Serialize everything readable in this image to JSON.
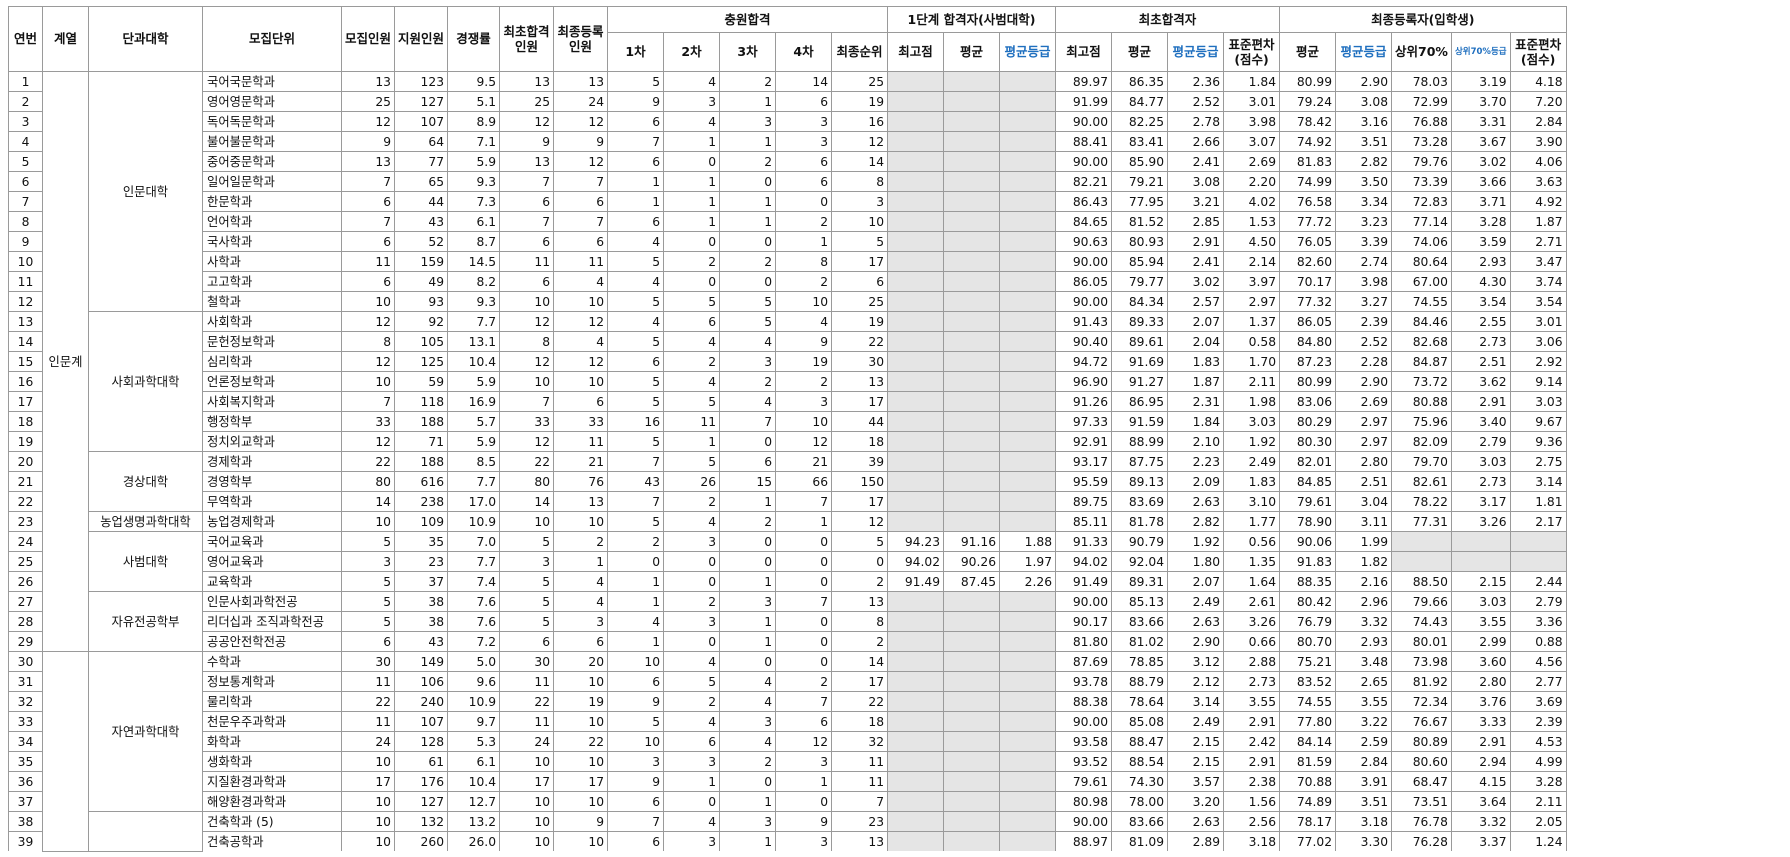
{
  "headers": {
    "idx": "연번",
    "field": "계열",
    "college": "단과대학",
    "unit": "모집단위",
    "quota": "모집인원",
    "applicants": "지원인원",
    "ratio": "경쟁률",
    "init_pass": "최초합격 인원",
    "final_reg": "최종등록 인원",
    "waitlist": "충원합격",
    "w1": "1차",
    "w2": "2차",
    "w3": "3차",
    "w4": "4차",
    "final_rank": "최종순위",
    "stage1": "1단계 합격자(사범대학)",
    "s1_max": "최고점",
    "s1_avg": "평균",
    "s1_grade": "평균등급",
    "initial": "최초합격자",
    "i_max": "최고점",
    "i_avg": "평균",
    "i_grade": "평균등급",
    "i_sd": "표준편차 (점수)",
    "finalreg": "최종등록자(입학생)",
    "f_avg": "평균",
    "f_grade": "평균등급",
    "f_top70": "상위70%",
    "f_top70g": "상위70%등급",
    "f_sd": "표준편차 (점수)"
  },
  "fields": [
    {
      "name": "인문계",
      "span": 29
    },
    {
      "name": "",
      "span": 10
    }
  ],
  "colleges": [
    {
      "name": "인문대학",
      "span": 12
    },
    {
      "name": "사회과학대학",
      "span": 7
    },
    {
      "name": "경상대학",
      "span": 3
    },
    {
      "name": "농업생명과학대학",
      "span": 1
    },
    {
      "name": "사범대학",
      "span": 3
    },
    {
      "name": "자유전공학부",
      "span": 3
    },
    {
      "name": "자연과학대학",
      "span": 8
    },
    {
      "name": "",
      "span": 2
    }
  ],
  "rows": [
    [
      "1",
      "국어국문학과",
      "13",
      "123",
      "9.5",
      "13",
      "13",
      "5",
      "4",
      "2",
      "14",
      "25",
      "",
      "",
      "",
      "89.97",
      "86.35",
      "2.36",
      "1.84",
      "80.99",
      "2.90",
      "78.03",
      "3.19",
      "4.18"
    ],
    [
      "2",
      "영어영문학과",
      "25",
      "127",
      "5.1",
      "25",
      "24",
      "9",
      "3",
      "1",
      "6",
      "19",
      "",
      "",
      "",
      "91.99",
      "84.77",
      "2.52",
      "3.01",
      "79.24",
      "3.08",
      "72.99",
      "3.70",
      "7.20"
    ],
    [
      "3",
      "독어독문학과",
      "12",
      "107",
      "8.9",
      "12",
      "12",
      "6",
      "4",
      "3",
      "3",
      "16",
      "",
      "",
      "",
      "90.00",
      "82.25",
      "2.78",
      "3.98",
      "78.42",
      "3.16",
      "76.88",
      "3.31",
      "2.84"
    ],
    [
      "4",
      "불어불문학과",
      "9",
      "64",
      "7.1",
      "9",
      "9",
      "7",
      "1",
      "1",
      "3",
      "12",
      "",
      "",
      "",
      "88.41",
      "83.41",
      "2.66",
      "3.07",
      "74.92",
      "3.51",
      "73.28",
      "3.67",
      "3.90"
    ],
    [
      "5",
      "중어중문학과",
      "13",
      "77",
      "5.9",
      "13",
      "12",
      "6",
      "0",
      "2",
      "6",
      "14",
      "",
      "",
      "",
      "90.00",
      "85.90",
      "2.41",
      "2.69",
      "81.83",
      "2.82",
      "79.76",
      "3.02",
      "4.06"
    ],
    [
      "6",
      "일어일문학과",
      "7",
      "65",
      "9.3",
      "7",
      "7",
      "1",
      "1",
      "0",
      "6",
      "8",
      "",
      "",
      "",
      "82.21",
      "79.21",
      "3.08",
      "2.20",
      "74.99",
      "3.50",
      "73.39",
      "3.66",
      "3.63"
    ],
    [
      "7",
      "한문학과",
      "6",
      "44",
      "7.3",
      "6",
      "6",
      "1",
      "1",
      "1",
      "0",
      "3",
      "",
      "",
      "",
      "86.43",
      "77.95",
      "3.21",
      "4.02",
      "76.58",
      "3.34",
      "72.83",
      "3.71",
      "4.92"
    ],
    [
      "8",
      "언어학과",
      "7",
      "43",
      "6.1",
      "7",
      "7",
      "6",
      "1",
      "1",
      "2",
      "10",
      "",
      "",
      "",
      "84.65",
      "81.52",
      "2.85",
      "1.53",
      "77.72",
      "3.23",
      "77.14",
      "3.28",
      "1.87"
    ],
    [
      "9",
      "국사학과",
      "6",
      "52",
      "8.7",
      "6",
      "6",
      "4",
      "0",
      "0",
      "1",
      "5",
      "",
      "",
      "",
      "90.63",
      "80.93",
      "2.91",
      "4.50",
      "76.05",
      "3.39",
      "74.06",
      "3.59",
      "2.71"
    ],
    [
      "10",
      "사학과",
      "11",
      "159",
      "14.5",
      "11",
      "11",
      "5",
      "2",
      "2",
      "8",
      "17",
      "",
      "",
      "",
      "90.00",
      "85.94",
      "2.41",
      "2.14",
      "82.60",
      "2.74",
      "80.64",
      "2.93",
      "3.47"
    ],
    [
      "11",
      "고고학과",
      "6",
      "49",
      "8.2",
      "6",
      "4",
      "4",
      "0",
      "0",
      "2",
      "6",
      "",
      "",
      "",
      "86.05",
      "79.77",
      "3.02",
      "3.97",
      "70.17",
      "3.98",
      "67.00",
      "4.30",
      "3.74"
    ],
    [
      "12",
      "철학과",
      "10",
      "93",
      "9.3",
      "10",
      "10",
      "5",
      "5",
      "5",
      "10",
      "25",
      "",
      "",
      "",
      "90.00",
      "84.34",
      "2.57",
      "2.97",
      "77.32",
      "3.27",
      "74.55",
      "3.54",
      "3.54"
    ],
    [
      "13",
      "사회학과",
      "12",
      "92",
      "7.7",
      "12",
      "12",
      "4",
      "6",
      "5",
      "4",
      "19",
      "",
      "",
      "",
      "91.43",
      "89.33",
      "2.07",
      "1.37",
      "86.05",
      "2.39",
      "84.46",
      "2.55",
      "3.01"
    ],
    [
      "14",
      "문헌정보학과",
      "8",
      "105",
      "13.1",
      "8",
      "4",
      "5",
      "4",
      "4",
      "9",
      "22",
      "",
      "",
      "",
      "90.40",
      "89.61",
      "2.04",
      "0.58",
      "84.80",
      "2.52",
      "82.68",
      "2.73",
      "3.06"
    ],
    [
      "15",
      "심리학과",
      "12",
      "125",
      "10.4",
      "12",
      "12",
      "6",
      "2",
      "3",
      "19",
      "30",
      "",
      "",
      "",
      "94.72",
      "91.69",
      "1.83",
      "1.70",
      "87.23",
      "2.28",
      "84.87",
      "2.51",
      "2.92"
    ],
    [
      "16",
      "언론정보학과",
      "10",
      "59",
      "5.9",
      "10",
      "10",
      "5",
      "4",
      "2",
      "2",
      "13",
      "",
      "",
      "",
      "96.90",
      "91.27",
      "1.87",
      "2.11",
      "80.99",
      "2.90",
      "73.72",
      "3.62",
      "9.14"
    ],
    [
      "17",
      "사회복지학과",
      "7",
      "118",
      "16.9",
      "7",
      "6",
      "5",
      "5",
      "4",
      "3",
      "17",
      "",
      "",
      "",
      "91.26",
      "86.95",
      "2.31",
      "1.98",
      "83.06",
      "2.69",
      "80.88",
      "2.91",
      "3.03"
    ],
    [
      "18",
      "행정학부",
      "33",
      "188",
      "5.7",
      "33",
      "33",
      "16",
      "11",
      "7",
      "10",
      "44",
      "",
      "",
      "",
      "97.33",
      "91.59",
      "1.84",
      "3.03",
      "80.29",
      "2.97",
      "75.96",
      "3.40",
      "9.67"
    ],
    [
      "19",
      "정치외교학과",
      "12",
      "71",
      "5.9",
      "12",
      "11",
      "5",
      "1",
      "0",
      "12",
      "18",
      "",
      "",
      "",
      "92.91",
      "88.99",
      "2.10",
      "1.92",
      "80.30",
      "2.97",
      "82.09",
      "2.79",
      "9.36"
    ],
    [
      "20",
      "경제학과",
      "22",
      "188",
      "8.5",
      "22",
      "21",
      "7",
      "5",
      "6",
      "21",
      "39",
      "",
      "",
      "",
      "93.17",
      "87.75",
      "2.23",
      "2.49",
      "82.01",
      "2.80",
      "79.70",
      "3.03",
      "2.75"
    ],
    [
      "21",
      "경영학부",
      "80",
      "616",
      "7.7",
      "80",
      "76",
      "43",
      "26",
      "15",
      "66",
      "150",
      "",
      "",
      "",
      "95.59",
      "89.13",
      "2.09",
      "1.83",
      "84.85",
      "2.51",
      "82.61",
      "2.73",
      "3.14"
    ],
    [
      "22",
      "무역학과",
      "14",
      "238",
      "17.0",
      "14",
      "13",
      "7",
      "2",
      "1",
      "7",
      "17",
      "",
      "",
      "",
      "89.75",
      "83.69",
      "2.63",
      "3.10",
      "79.61",
      "3.04",
      "78.22",
      "3.17",
      "1.81"
    ],
    [
      "23",
      "농업경제학과",
      "10",
      "109",
      "10.9",
      "10",
      "10",
      "5",
      "4",
      "2",
      "1",
      "12",
      "",
      "",
      "",
      "85.11",
      "81.78",
      "2.82",
      "1.77",
      "78.90",
      "3.11",
      "77.31",
      "3.26",
      "2.17"
    ],
    [
      "24",
      "국어교육과",
      "5",
      "35",
      "7.0",
      "5",
      "2",
      "2",
      "3",
      "0",
      "0",
      "5",
      "94.23",
      "91.16",
      "1.88",
      "91.33",
      "90.79",
      "1.92",
      "0.56",
      "90.06",
      "1.99",
      "",
      "",
      ""
    ],
    [
      "25",
      "영어교육과",
      "3",
      "23",
      "7.7",
      "3",
      "1",
      "0",
      "0",
      "0",
      "0",
      "0",
      "94.02",
      "90.26",
      "1.97",
      "94.02",
      "92.04",
      "1.80",
      "1.35",
      "91.83",
      "1.82",
      "",
      "",
      ""
    ],
    [
      "26",
      "교육학과",
      "5",
      "37",
      "7.4",
      "5",
      "4",
      "1",
      "0",
      "1",
      "0",
      "2",
      "91.49",
      "87.45",
      "2.26",
      "91.49",
      "89.31",
      "2.07",
      "1.64",
      "88.35",
      "2.16",
      "88.50",
      "2.15",
      "2.44"
    ],
    [
      "27",
      "인문사회과학전공",
      "5",
      "38",
      "7.6",
      "5",
      "4",
      "1",
      "2",
      "3",
      "7",
      "13",
      "",
      "",
      "",
      "90.00",
      "85.13",
      "2.49",
      "2.61",
      "80.42",
      "2.96",
      "79.66",
      "3.03",
      "2.79"
    ],
    [
      "28",
      "리더십과 조직과학전공",
      "5",
      "38",
      "7.6",
      "5",
      "3",
      "4",
      "3",
      "1",
      "0",
      "8",
      "",
      "",
      "",
      "90.17",
      "83.66",
      "2.63",
      "3.26",
      "76.79",
      "3.32",
      "74.43",
      "3.55",
      "3.36"
    ],
    [
      "29",
      "공공안전학전공",
      "6",
      "43",
      "7.2",
      "6",
      "6",
      "1",
      "0",
      "1",
      "0",
      "2",
      "",
      "",
      "",
      "81.80",
      "81.02",
      "2.90",
      "0.66",
      "80.70",
      "2.93",
      "80.01",
      "2.99",
      "0.88"
    ],
    [
      "30",
      "수학과",
      "30",
      "149",
      "5.0",
      "30",
      "20",
      "10",
      "4",
      "0",
      "0",
      "14",
      "",
      "",
      "",
      "87.69",
      "78.85",
      "3.12",
      "2.88",
      "75.21",
      "3.48",
      "73.98",
      "3.60",
      "4.56"
    ],
    [
      "31",
      "정보통계학과",
      "11",
      "106",
      "9.6",
      "11",
      "10",
      "6",
      "5",
      "4",
      "2",
      "17",
      "",
      "",
      "",
      "93.78",
      "88.79",
      "2.12",
      "2.73",
      "83.52",
      "2.65",
      "81.92",
      "2.80",
      "2.77"
    ],
    [
      "32",
      "물리학과",
      "22",
      "240",
      "10.9",
      "22",
      "19",
      "9",
      "2",
      "4",
      "7",
      "22",
      "",
      "",
      "",
      "88.38",
      "78.64",
      "3.14",
      "3.55",
      "74.55",
      "3.55",
      "72.34",
      "3.76",
      "3.69"
    ],
    [
      "33",
      "천문우주과학과",
      "11",
      "107",
      "9.7",
      "11",
      "10",
      "5",
      "4",
      "3",
      "6",
      "18",
      "",
      "",
      "",
      "90.00",
      "85.08",
      "2.49",
      "2.91",
      "77.80",
      "3.22",
      "76.67",
      "3.33",
      "2.39"
    ],
    [
      "34",
      "화학과",
      "24",
      "128",
      "5.3",
      "24",
      "22",
      "10",
      "6",
      "4",
      "12",
      "32",
      "",
      "",
      "",
      "93.58",
      "88.47",
      "2.15",
      "2.42",
      "84.14",
      "2.59",
      "80.89",
      "2.91",
      "4.53"
    ],
    [
      "35",
      "생화학과",
      "10",
      "61",
      "6.1",
      "10",
      "10",
      "3",
      "3",
      "2",
      "3",
      "11",
      "",
      "",
      "",
      "93.52",
      "88.54",
      "2.15",
      "2.91",
      "81.59",
      "2.84",
      "80.60",
      "2.94",
      "4.99"
    ],
    [
      "36",
      "지질환경과학과",
      "17",
      "176",
      "10.4",
      "17",
      "17",
      "9",
      "1",
      "0",
      "1",
      "11",
      "",
      "",
      "",
      "79.61",
      "74.30",
      "3.57",
      "2.38",
      "70.88",
      "3.91",
      "68.47",
      "4.15",
      "3.28"
    ],
    [
      "37",
      "해양환경과학과",
      "10",
      "127",
      "12.7",
      "10",
      "10",
      "6",
      "0",
      "1",
      "0",
      "7",
      "",
      "",
      "",
      "80.98",
      "78.00",
      "3.20",
      "1.56",
      "74.89",
      "3.51",
      "73.51",
      "3.64",
      "2.11"
    ],
    [
      "38",
      "건축학과 (5)",
      "10",
      "132",
      "13.2",
      "10",
      "9",
      "7",
      "4",
      "3",
      "9",
      "23",
      "",
      "",
      "",
      "90.00",
      "83.66",
      "2.63",
      "2.56",
      "78.17",
      "3.18",
      "76.78",
      "3.32",
      "2.05"
    ],
    [
      "39",
      "건축공학과",
      "10",
      "260",
      "26.0",
      "10",
      "10",
      "6",
      "3",
      "1",
      "3",
      "13",
      "",
      "",
      "",
      "88.97",
      "81.09",
      "2.89",
      "3.18",
      "77.02",
      "3.30",
      "76.28",
      "3.37",
      "1.24"
    ]
  ]
}
